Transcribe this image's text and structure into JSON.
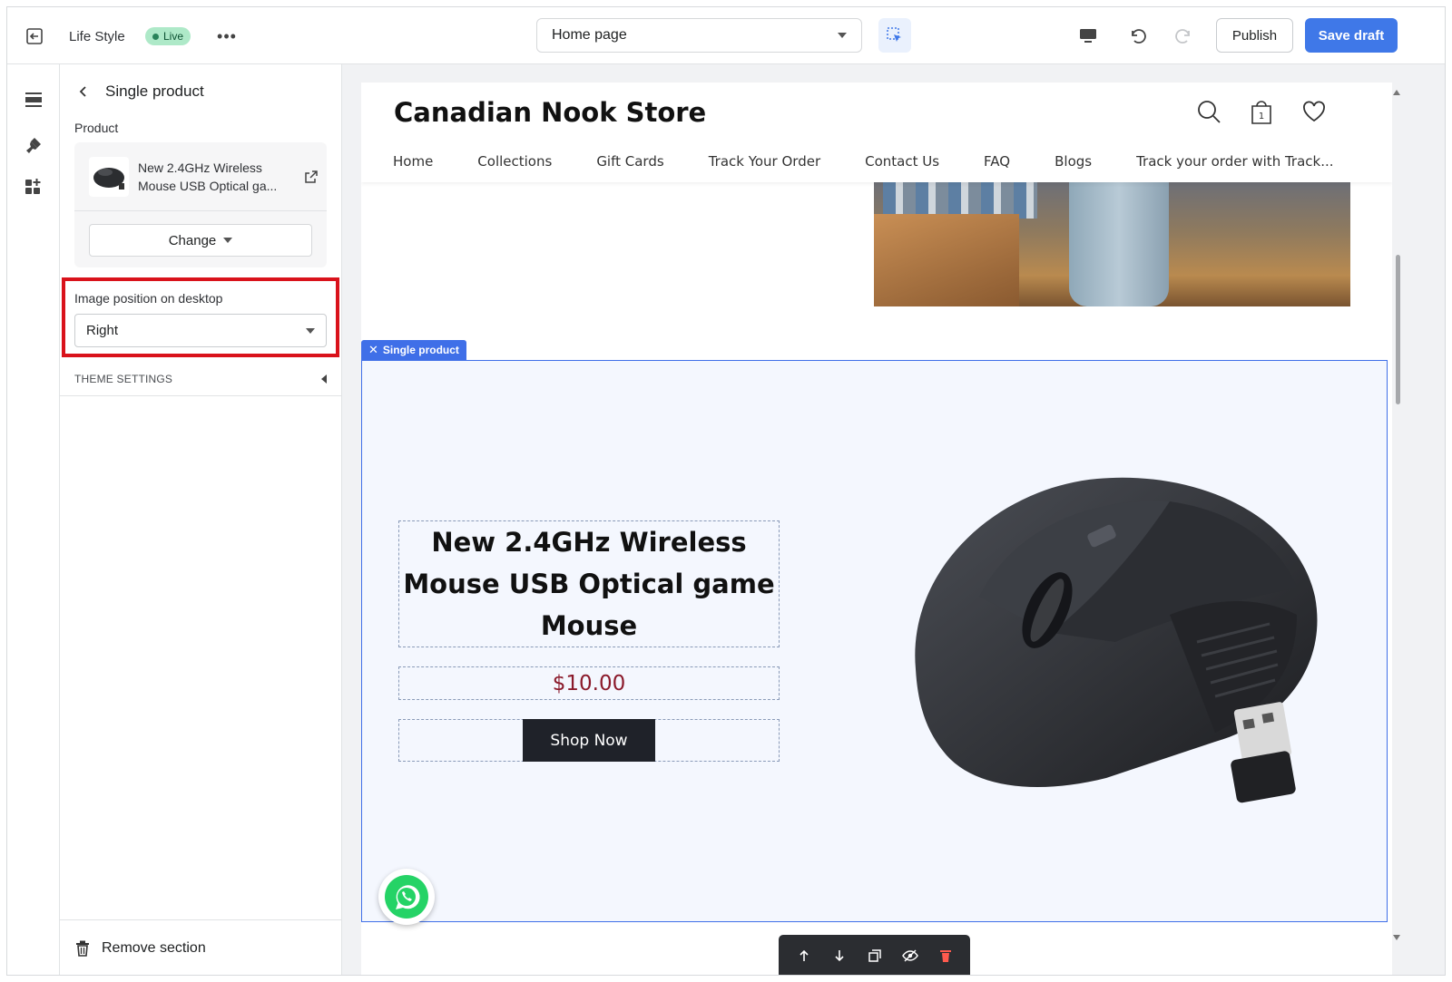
{
  "topbar": {
    "app_name": "Life Style",
    "live_label": "Live",
    "more_label": "•••",
    "page_select": "Home page",
    "publish_label": "Publish",
    "save_label": "Save draft"
  },
  "panel": {
    "title": "Single product",
    "product_label": "Product",
    "product_name": "New 2.4GHz Wireless Mouse USB Optical ga...",
    "change_label": "Change",
    "image_position_label": "Image position on desktop",
    "image_position_value": "Right",
    "theme_settings_label": "THEME SETTINGS",
    "remove_section_label": "Remove section"
  },
  "store": {
    "name": "Canadian Nook Store",
    "cart_count": "1",
    "nav": [
      "Home",
      "Collections",
      "Gift Cards",
      "Track Your Order",
      "Contact Us",
      "FAQ",
      "Blogs",
      "Track your order with Track..."
    ],
    "section_tag": "Single product",
    "product_title": "New 2.4GHz Wireless Mouse USB Optical game Mouse",
    "price": "$10.00",
    "cta": "Shop Now"
  },
  "colors": {
    "accent": "#3f78e8",
    "highlight": "#d9121b",
    "live_bg": "#aee9c8",
    "price": "#8b1a2b"
  }
}
